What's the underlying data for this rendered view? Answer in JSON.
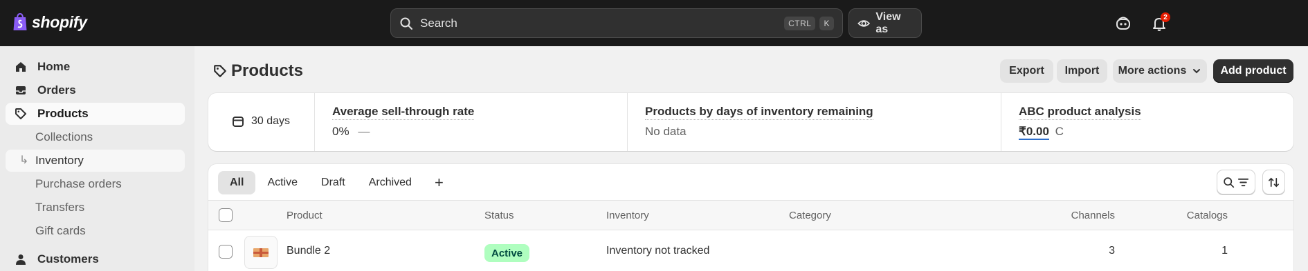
{
  "topbar": {
    "logo_text": "shopify",
    "search_placeholder": "Search",
    "shortcut_keys": [
      "CTRL",
      "K"
    ],
    "view_as_label": "View as",
    "notification_count": "2"
  },
  "sidebar": {
    "items": [
      {
        "label": "Home",
        "icon": "home-icon"
      },
      {
        "label": "Orders",
        "icon": "inbox-icon"
      },
      {
        "label": "Products",
        "icon": "tag-icon"
      },
      {
        "label": "Collections"
      },
      {
        "label": "Inventory"
      },
      {
        "label": "Purchase orders"
      },
      {
        "label": "Transfers"
      },
      {
        "label": "Gift cards"
      },
      {
        "label": "Customers",
        "icon": "person-icon"
      }
    ]
  },
  "page": {
    "title": "Products",
    "buttons": {
      "export": "Export",
      "import": "Import",
      "more_actions": "More actions",
      "add_product": "Add product"
    }
  },
  "metrics": {
    "period": "30 days",
    "sell_through": {
      "title": "Average sell-through rate",
      "value": "0%",
      "trend": "—"
    },
    "days_inventory": {
      "title": "Products by days of inventory remaining",
      "value": "No data"
    },
    "abc": {
      "title": "ABC product analysis",
      "value": "₹0.00",
      "suffix": "C"
    }
  },
  "filters": {
    "tabs": [
      "All",
      "Active",
      "Draft",
      "Archived"
    ],
    "add_tab": "+"
  },
  "table": {
    "headers": [
      "Product",
      "Status",
      "Inventory",
      "Category",
      "Channels",
      "Catalogs"
    ],
    "rows": [
      {
        "product": "Bundle 2",
        "status": "Active",
        "inventory": "Inventory not tracked",
        "category": "",
        "channels": "3",
        "catalogs": "1"
      }
    ]
  },
  "colors": {
    "topbar_bg": "#1a1a1a",
    "sidebar_bg": "#ebebeb",
    "content_bg": "#f1f1f1",
    "active_badge_bg": "#affebf",
    "primary_button": "#303030",
    "logo_green": "#95bf47"
  }
}
